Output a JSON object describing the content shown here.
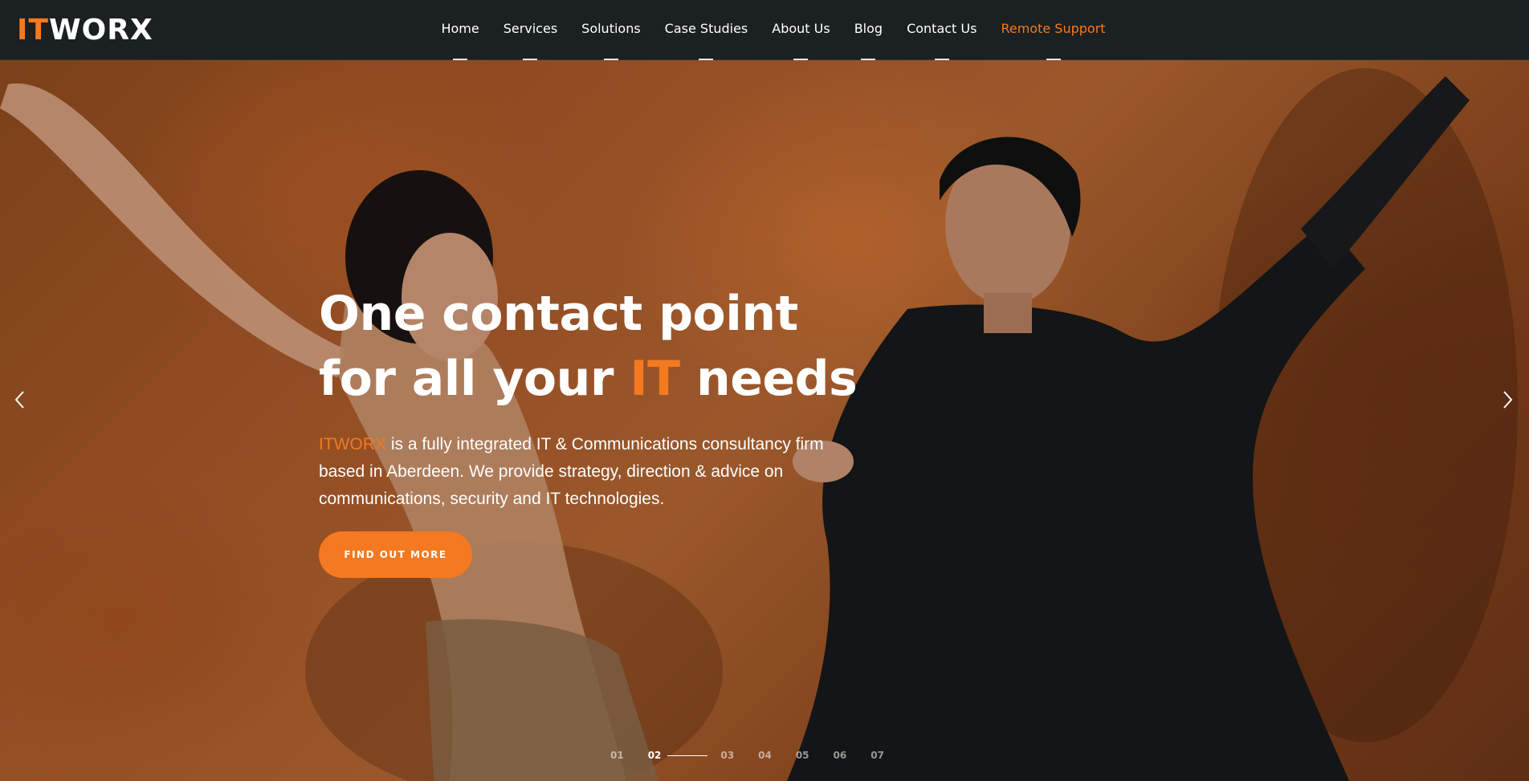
{
  "brand": {
    "logo_prefix": "IT",
    "logo_suffix": "WORX",
    "accent_color": "#f47920",
    "header_bg": "#1b2022"
  },
  "nav": {
    "items": [
      {
        "label": "Home"
      },
      {
        "label": "Services"
      },
      {
        "label": "Solutions"
      },
      {
        "label": "Case Studies"
      },
      {
        "label": "About Us"
      },
      {
        "label": "Blog"
      },
      {
        "label": "Contact Us"
      },
      {
        "label": "Remote Support"
      }
    ]
  },
  "hero": {
    "headline_line1": "One contact point",
    "headline_line2_pre": "for all your ",
    "headline_line2_accent": "IT",
    "headline_line2_post": " needs",
    "lede_brand": "ITWORX",
    "lede_text": " is a fully integrated IT & Communications consultancy firm based in Aberdeen. We provide strategy, direction & advice on communications, security and IT technologies.",
    "cta_label": "FIND OUT MORE",
    "prev_icon": "chevron-left-icon",
    "next_icon": "chevron-right-icon"
  },
  "slider": {
    "active": "02",
    "slides": [
      "01",
      "02",
      "03",
      "04",
      "05",
      "06",
      "07"
    ]
  }
}
